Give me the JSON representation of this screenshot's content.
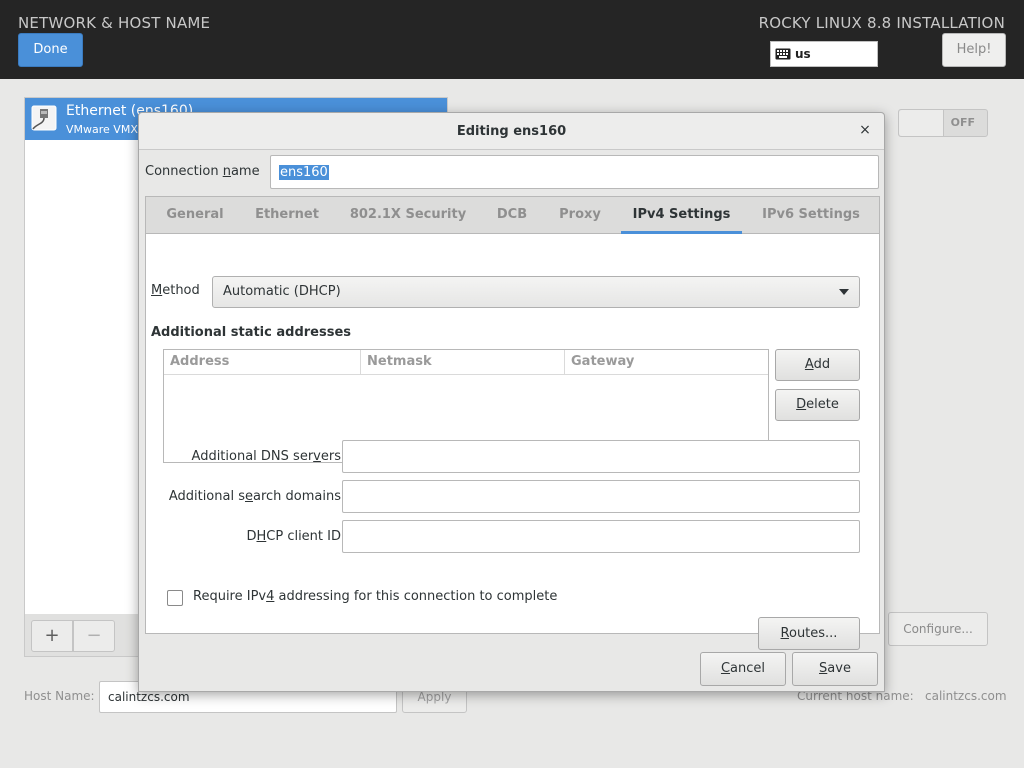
{
  "header": {
    "title": "NETWORK & HOST NAME",
    "product": "ROCKY LINUX 8.8 INSTALLATION",
    "done_label": "Done",
    "keyboard_layout": "us",
    "help_label": "Help!"
  },
  "devices": {
    "items": [
      {
        "name": "Ethernet (ens160)",
        "description": "VMware VMXN",
        "selected": true
      }
    ],
    "add_symbol": "+",
    "remove_symbol": "−"
  },
  "device_panel": {
    "toggle_state": "OFF",
    "configure_label": "Configure..."
  },
  "hostname": {
    "label": "Host Name:",
    "value": "calintzcs.com",
    "apply_label": "Apply",
    "current_label": "Current host name:",
    "current_value": "calintzcs.com"
  },
  "dialog": {
    "title": "Editing ens160",
    "close_glyph": "×",
    "connection_name_label_pre": "Connection ",
    "connection_name_label_mnemonic": "n",
    "connection_name_label_post": "ame",
    "connection_name_value": "ens160",
    "tabs": [
      {
        "label": "General",
        "active": false
      },
      {
        "label": "Ethernet",
        "active": false
      },
      {
        "label": "802.1X Security",
        "active": false
      },
      {
        "label": "DCB",
        "active": false
      },
      {
        "label": "Proxy",
        "active": false
      },
      {
        "label": "IPv4 Settings",
        "active": true
      },
      {
        "label": "IPv6 Settings",
        "active": false
      }
    ],
    "ipv4": {
      "method_label_mnemonic": "M",
      "method_label_rest": "ethod",
      "method_value": "Automatic (DHCP)",
      "addresses_heading": "Additional static addresses",
      "columns": [
        "Address",
        "Netmask",
        "Gateway"
      ],
      "add_mnemonic": "A",
      "add_rest": "dd",
      "delete_mnemonic": "D",
      "delete_rest": "elete",
      "dns_label_pre": "Additional DNS ser",
      "dns_label_mnemonic": "v",
      "dns_label_post": "ers",
      "dns_value": "",
      "search_label_pre": "Additional s",
      "search_label_mnemonic": "e",
      "search_label_post": "arch domains",
      "search_value": "",
      "dhcp_label_pre": "D",
      "dhcp_label_mnemonic": "H",
      "dhcp_label_post": "CP client ID",
      "dhcp_value": "",
      "require_label_pre": "Require IPv",
      "require_label_mnemonic": "4",
      "require_label_post": " addressing for this connection to complete",
      "require_checked": false,
      "routes_mnemonic": "R",
      "routes_rest": "outes..."
    },
    "cancel_mnemonic": "C",
    "cancel_rest": "ancel",
    "save_mnemonic": "S",
    "save_rest": "ave"
  }
}
